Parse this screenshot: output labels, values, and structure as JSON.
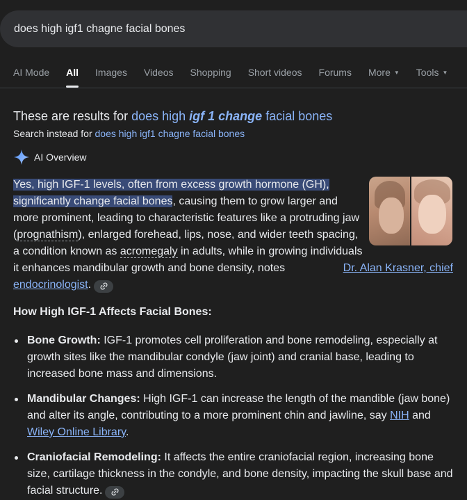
{
  "search": {
    "query": "does high igf1 chagne facial bones"
  },
  "tabs": [
    {
      "label": "AI Mode"
    },
    {
      "label": "All"
    },
    {
      "label": "Images"
    },
    {
      "label": "Videos"
    },
    {
      "label": "Shopping"
    },
    {
      "label": "Short videos"
    },
    {
      "label": "Forums"
    },
    {
      "label": "More"
    },
    {
      "label": "Tools"
    }
  ],
  "correction": {
    "prefix": "These are results for ",
    "q1": "does high ",
    "q_em": "igf 1 change",
    "q2": " facial bones",
    "instead_prefix": "Search instead for ",
    "instead_link": "does high igf1 chagne facial bones"
  },
  "ai_overview": {
    "title": "AI Overview",
    "para": {
      "hl1": "Yes, high IGF-1 levels, often from excess growth hormone (GH),",
      "hl2": "significantly change facial bones",
      "t1": ", causing them to grow larger and more prominent, leading to characteristic features like a protruding jaw (",
      "prognathism": "prognathism",
      "t2": "), enlarged forehead, lips, nose, and wider teeth spacing, a condition known as ",
      "acromegaly": "acromegaly",
      "t3": " in adults, while in growing individuals it enhances mandibular growth and bone density, notes ",
      "link": "Dr. Alan Krasner, chief endocrinologist",
      "t4": "."
    },
    "subheading": "How High IGF-1 Affects Facial Bones:",
    "bullets": [
      {
        "title": "Bone Growth:",
        "text": " IGF-1 promotes cell proliferation and bone remodeling, especially at growth sites like the mandibular condyle (jaw joint) and cranial base, leading to increased bone mass and dimensions."
      },
      {
        "title": "Mandibular Changes:",
        "text": " High IGF-1 can increase the length of the mandible (jaw bone) and alter its angle, contributing to a more prominent chin and jawline, say ",
        "link1": "NIH",
        "mid": " and ",
        "link2": "Wiley Online Library",
        "end": "."
      },
      {
        "title": "Craniofacial Remodeling:",
        "text": " It affects the entire craniofacial region, increasing bone size, cartilage thickness in the condyle, and bone density, impacting the skull base and facial structure."
      }
    ]
  },
  "colors": {
    "background": "#1f1f1f",
    "link": "#8ab4f8",
    "highlight": "#394b77",
    "searchbar": "#303134"
  }
}
